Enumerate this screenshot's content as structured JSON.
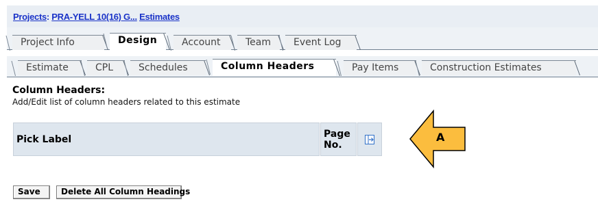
{
  "breadcrumb": {
    "projects_label": "Projects",
    "separator": ":",
    "project_name": "PRA-YELL 10(16) G...",
    "current_page": "Estimates"
  },
  "top_tabs": [
    {
      "label": "Project Info",
      "active": false
    },
    {
      "label": "Design",
      "active": true
    },
    {
      "label": "Account",
      "active": false
    },
    {
      "label": "Team",
      "active": false
    },
    {
      "label": "Event Log",
      "active": false
    }
  ],
  "sub_tabs": [
    {
      "label": "Estimate",
      "active": false
    },
    {
      "label": "CPL",
      "active": false
    },
    {
      "label": "Schedules",
      "active": false
    },
    {
      "label": "Column Headers",
      "active": true
    },
    {
      "label": "Pay Items",
      "active": false
    },
    {
      "label": "Construction Estimates",
      "active": false
    }
  ],
  "section": {
    "title": "Column Headers:",
    "description": "Add/Edit list of column headers related to this estimate"
  },
  "table": {
    "headers": [
      "Pick Label",
      "Page No."
    ],
    "action_icon": "add-column-icon"
  },
  "callout": {
    "label": "A",
    "color": "#fbbd3e"
  },
  "buttons": {
    "save": "Save",
    "delete_all": "Delete All Column Headings"
  },
  "colors": {
    "link": "#1a33c8",
    "header_bar": "#e9eef4",
    "table_cell": "#dee6ee",
    "icon_blue": "#2f6fc8"
  }
}
